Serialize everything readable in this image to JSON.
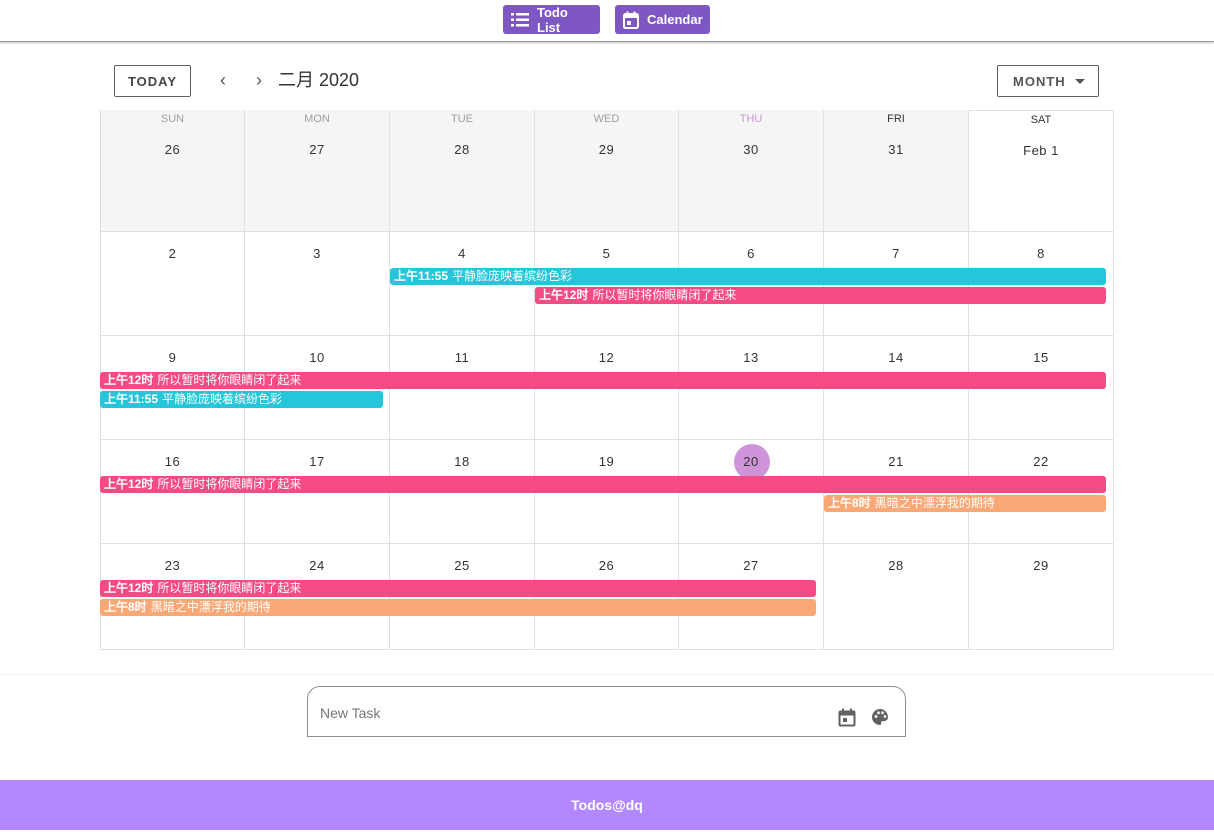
{
  "nav": {
    "todo_label": "Todo List",
    "calendar_label": "Calendar"
  },
  "toolbar": {
    "today_label": "TODAY",
    "prev_label": "‹",
    "next_label": "›",
    "title": "二月 2020",
    "view_label": "MONTH"
  },
  "calendar": {
    "weekdays": [
      "SUN",
      "MON",
      "TUE",
      "WED",
      "THU",
      "FRI",
      "SAT"
    ],
    "weeks": [
      [
        "26",
        "27",
        "28",
        "29",
        "30",
        "31",
        "Feb 1"
      ],
      [
        "2",
        "3",
        "4",
        "5",
        "6",
        "7",
        "8"
      ],
      [
        "9",
        "10",
        "11",
        "12",
        "13",
        "14",
        "15"
      ],
      [
        "16",
        "17",
        "18",
        "19",
        "20",
        "21",
        "22"
      ],
      [
        "23",
        "24",
        "25",
        "26",
        "27",
        "28",
        "29"
      ]
    ],
    "today": "20",
    "events": [
      {
        "time": "上午11:55",
        "title": "平静脸庞映着缤纷色彩",
        "color": "#26c6da"
      },
      {
        "time": "上午12时",
        "title": "所以暂时将你眼睛闭了起来",
        "color": "#f44b86"
      },
      {
        "time": "上午12时",
        "title": "所以暂时将你眼睛闭了起来",
        "color": "#f44b86"
      },
      {
        "time": "上午11:55",
        "title": "平静脸庞映着缤纷色彩",
        "color": "#26c6da"
      },
      {
        "time": "上午12时",
        "title": "所以暂时将你眼睛闭了起来",
        "color": "#f44b86"
      },
      {
        "time": "上午8时",
        "title": "黑暗之中漂浮我的期待",
        "color": "#f9a875"
      },
      {
        "time": "上午12时",
        "title": "所以暂时将你眼睛闭了起来",
        "color": "#f44b86"
      },
      {
        "time": "上午8时",
        "title": "黑暗之中漂浮我的期待",
        "color": "#f9a875"
      }
    ]
  },
  "new_task": {
    "placeholder": "New Task"
  },
  "footer": {
    "text": "Todos@dq"
  },
  "colors": {
    "accent": "#7e57c2",
    "footer": "#b388ff",
    "today": "#ce93d8"
  },
  "icons": [
    "list-icon",
    "calendar-icon",
    "event-icon",
    "palette-icon"
  ]
}
